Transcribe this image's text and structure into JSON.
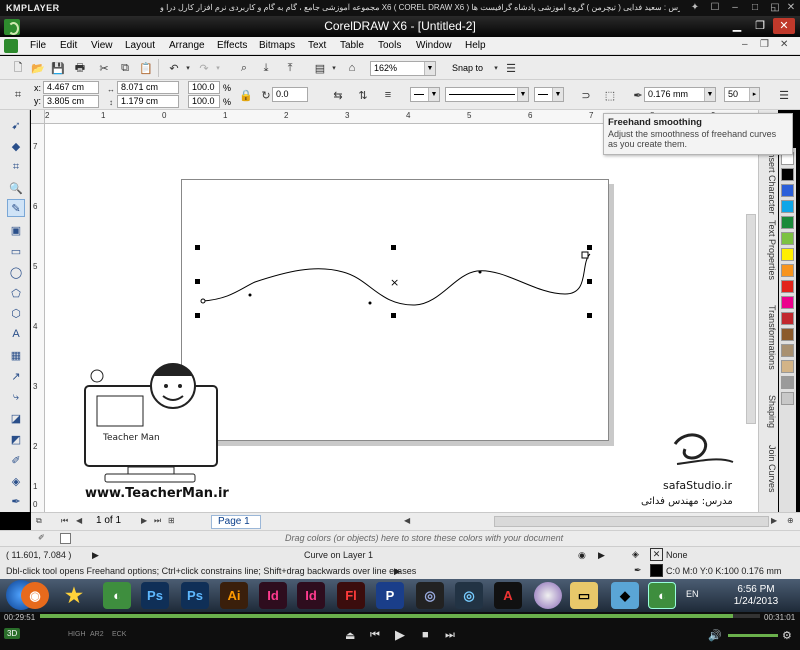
{
  "player": {
    "logo": "KMPLAYER",
    "title": "مجموعه آموزشی جامع ، گام به گام و کاربردی نرم افزار کارل درا و X6 ( COREL DRAW X6 )  مدرس : سعید فدایی ( تیچرمن ) گروه آموزشی پادشاه گرافیست ها",
    "time_elapsed": "00:29:51",
    "time_total": "00:31:01",
    "progress": 0.962,
    "modes": [
      "HIGH",
      "AR2",
      "ECK"
    ],
    "badge_3d": "3D"
  },
  "window": {
    "title": "CorelDRAW X6 - [Untitled-2]"
  },
  "menu": {
    "items": [
      "File",
      "Edit",
      "View",
      "Layout",
      "Arrange",
      "Effects",
      "Bitmaps",
      "Text",
      "Table",
      "Tools",
      "Window",
      "Help"
    ]
  },
  "standard_bar": {
    "zoom": "162%",
    "snap_to": "Snap to"
  },
  "property_bar": {
    "x": "4.467 cm",
    "y": "3.805 cm",
    "width": "8.071 cm",
    "height": "1.179 cm",
    "scale_x": "100.0",
    "scale_y": "100.0",
    "pct": "%",
    "rotation": "0.0",
    "outline_width": "0.176 mm",
    "smoothing": "50",
    "x_label": "x:",
    "y_label": "y:"
  },
  "tooltip": {
    "title": "Freehand smoothing",
    "body": "Adjust the smoothness of freehand curves as you create them."
  },
  "dockers": [
    "Insert Character",
    "Text Properties",
    "Transformations",
    "Shaping",
    "Join Curves"
  ],
  "ruler": {
    "h_ticks": [
      "2",
      "1",
      "0",
      "1",
      "2",
      "3",
      "4",
      "5",
      "6",
      "7",
      "8",
      "9"
    ],
    "v_ticks": [
      "7",
      "6",
      "5",
      "4",
      "3",
      "2",
      "1",
      "0"
    ],
    "unit": "centimeters"
  },
  "palette": {
    "colors": [
      "#ffffff",
      "#000000",
      "#2b5fd9",
      "#0ea6e8",
      "#1a8a3a",
      "#7cc242",
      "#ffef00",
      "#f7941d",
      "#e2231a",
      "#ec008c",
      "#c1272d",
      "#8b5a2b",
      "#a89070",
      "#d3b487",
      "#9a9a9a",
      "#c8c8c8"
    ]
  },
  "page_nav": {
    "page_count": "1 of 1",
    "page_tab": "Page 1"
  },
  "hint": "Drag colors (or objects) here to store these colors with your document",
  "status": {
    "coords": "( 11.601, 7.084 )",
    "object": "Curve on Layer 1",
    "tool_hint": "Dbl-click tool opens Freehand options; Ctrl+click constrains line; Shift+drag backwards over line erases",
    "fill": "None",
    "outline": "C:0 M:0 Y:0 K:100  0.176 mm"
  },
  "taskbar": {
    "time": "6:56 PM",
    "date": "1/24/2013",
    "lang": "EN"
  },
  "watermark": {
    "site1": "www.TeacherMan.ir",
    "site2": "safaStudio.ir",
    "brand": "Teacher Man",
    "credit": "مدرس: مهندس فدائی"
  }
}
